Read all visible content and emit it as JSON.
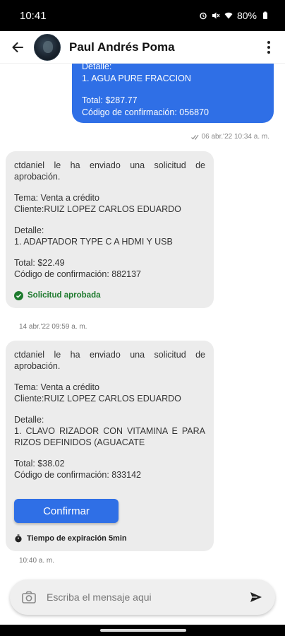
{
  "status_bar": {
    "time": "10:41",
    "battery": "80%"
  },
  "header": {
    "contact_name": "Paul Andrés Poma"
  },
  "messages": {
    "outgoing": {
      "lines": [
        "Detalle:",
        "1. AGUA PURE FRACCION"
      ],
      "total": "Total: $287.77",
      "code": "Código de confirmación: 056870",
      "timestamp": "06 abr.'22 10:34 a. m."
    },
    "request_1": {
      "intro": "ctdaniel le ha enviado una solicitud de aprobación.",
      "tema": "Tema: Venta a crédito",
      "cliente": "Cliente:RUIZ LOPEZ CARLOS EDUARDO",
      "detalle_label": "Detalle:",
      "item": "1. ADAPTADOR TYPE C A HDMI Y USB",
      "total": "Total: $22.49",
      "code": "Código de confirmación: 882137",
      "status": "Solicitud aprobada",
      "timestamp": "14 abr.'22 09:59 a. m."
    },
    "request_2": {
      "intro": "ctdaniel le ha enviado una solicitud de aprobación.",
      "tema": "Tema: Venta a crédito",
      "cliente": "Cliente:RUIZ LOPEZ CARLOS EDUARDO",
      "detalle_label": "Detalle:",
      "item": "1. CLAVO RIZADOR CON VITAMINA E PARA RIZOS DEFINIDOS (AGUACATE",
      "total": "Total: $38.02",
      "code": "Código de confirmación: 833142",
      "confirm_label": "Confirmar",
      "expiry": "Tiempo de expiración 5min",
      "timestamp": "10:40 a. m."
    }
  },
  "composer": {
    "placeholder": "Escriba el mensaje aqui"
  },
  "colors": {
    "accent": "#2f6fe6",
    "approved": "#1e7a2e",
    "bubble_in": "#ececec"
  }
}
